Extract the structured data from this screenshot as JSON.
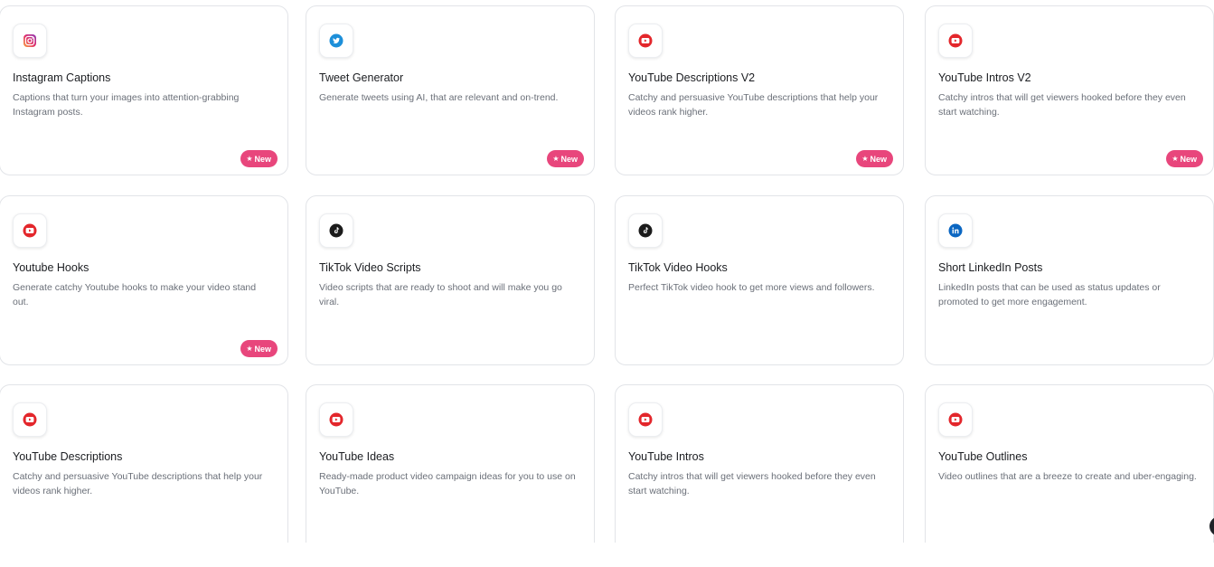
{
  "cards": [
    {
      "title": "Instagram Captions",
      "description": "Captions that turn your images into attention-grabbing Instagram posts.",
      "icon": "instagram-icon",
      "badge": "New"
    },
    {
      "title": "Tweet Generator",
      "description": "Generate tweets using AI, that are relevant and on-trend.",
      "icon": "twitter-icon",
      "badge": "New"
    },
    {
      "title": "YouTube Descriptions V2",
      "description": "Catchy and persuasive YouTube descriptions that help your videos rank higher.",
      "icon": "youtube-icon",
      "badge": "New"
    },
    {
      "title": "YouTube Intros V2",
      "description": "Catchy intros that will get viewers hooked before they even start watching.",
      "icon": "youtube-icon",
      "badge": "New"
    },
    {
      "title": "Youtube Hooks",
      "description": "Generate catchy Youtube hooks to make your video stand out.",
      "icon": "youtube-icon",
      "badge": "New"
    },
    {
      "title": "TikTok Video Scripts",
      "description": "Video scripts that are ready to shoot and will make you go viral.",
      "icon": "tiktok-icon",
      "badge": ""
    },
    {
      "title": "TikTok Video Hooks",
      "description": "Perfect TikTok video hook to get more views and followers.",
      "icon": "tiktok-icon",
      "badge": ""
    },
    {
      "title": "Short LinkedIn Posts",
      "description": "LinkedIn posts that can be used as status updates or promoted to get more engagement.",
      "icon": "linkedin-icon",
      "badge": ""
    },
    {
      "title": "YouTube Descriptions",
      "description": "Catchy and persuasive YouTube descriptions that help your videos rank higher.",
      "icon": "youtube-icon",
      "badge": ""
    },
    {
      "title": "YouTube Ideas",
      "description": "Ready-made product video campaign ideas for you to use on YouTube.",
      "icon": "youtube-icon",
      "badge": ""
    },
    {
      "title": "YouTube Intros",
      "description": "Catchy intros that will get viewers hooked before they even start watching.",
      "icon": "youtube-icon",
      "badge": ""
    },
    {
      "title": "YouTube Outlines",
      "description": "Video outlines that are a breeze to create and uber-engaging.",
      "icon": "youtube-icon",
      "badge": ""
    }
  ],
  "colors": {
    "badge": "#e8467c",
    "youtube": "#e3262b",
    "twitter": "#1d8fd9",
    "tiktok": "#1b1b1b",
    "linkedin": "#0a66c2"
  }
}
